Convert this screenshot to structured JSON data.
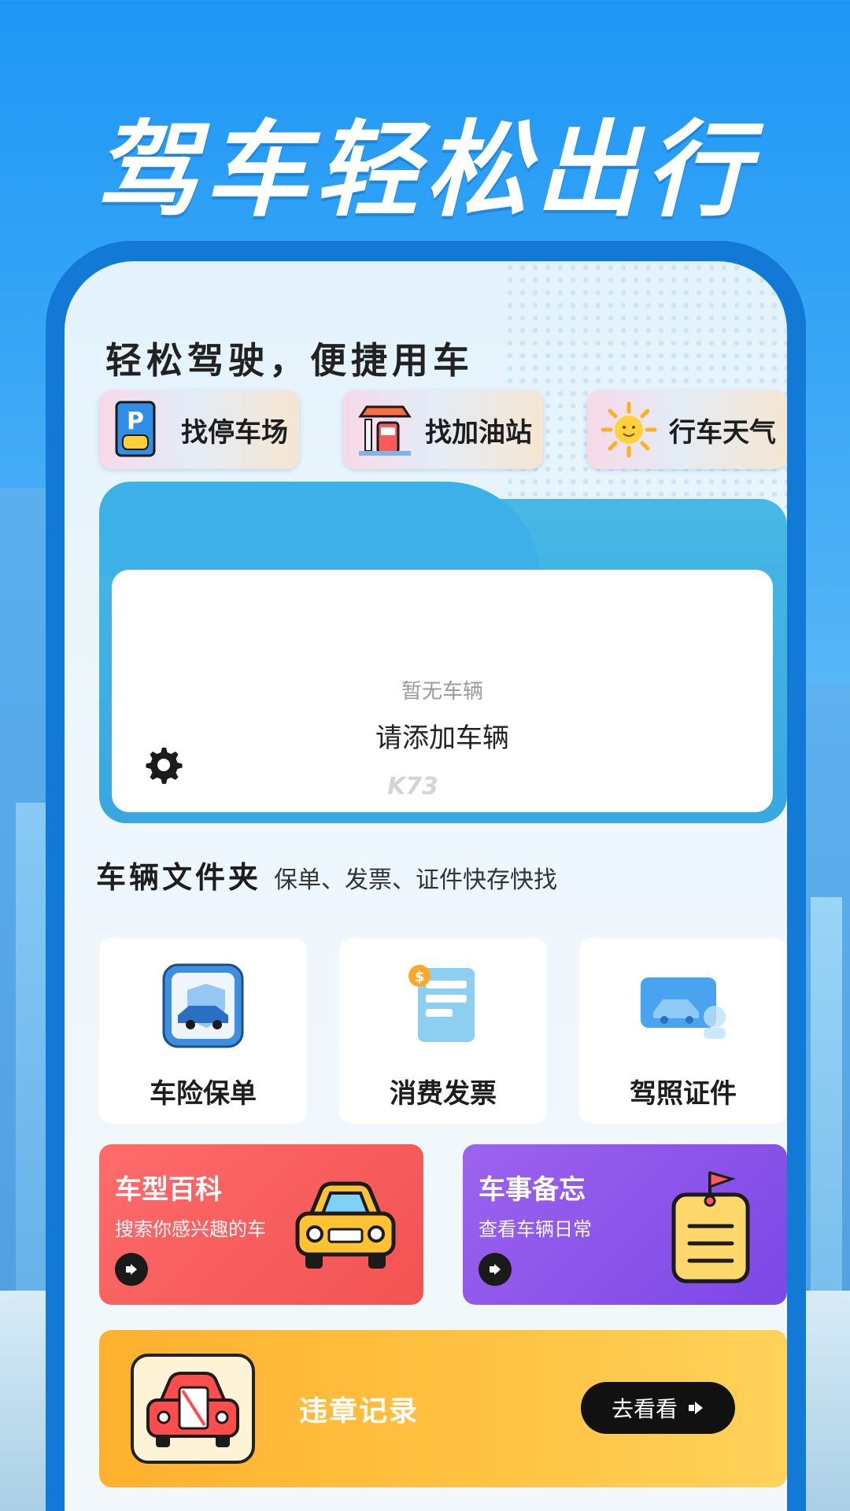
{
  "hero": {
    "title": "驾车轻松出行"
  },
  "screen": {
    "title": "轻松驾驶，便捷用车"
  },
  "quick_actions": [
    {
      "label": "找停车场",
      "icon": "parking-icon"
    },
    {
      "label": "找加油站",
      "icon": "gas-station-icon"
    },
    {
      "label": "行车天气",
      "icon": "sun-icon"
    }
  ],
  "vehicle": {
    "empty_text": "暂无车辆",
    "add_text": "请添加车辆",
    "watermark": "K73"
  },
  "folder": {
    "title": "车辆文件夹",
    "subtitle": "保单、发票、证件快存快找",
    "items": [
      {
        "label": "车险保单",
        "icon": "insurance-policy-icon"
      },
      {
        "label": "消费发票",
        "icon": "invoice-icon"
      },
      {
        "label": "驾照证件",
        "icon": "license-icon"
      }
    ]
  },
  "promos": [
    {
      "title": "车型百科",
      "subtitle": "搜索你感兴趣的车",
      "icon": "car-icon",
      "color": "#f25252"
    },
    {
      "title": "车事备忘",
      "subtitle": "查看车辆日常",
      "icon": "memo-icon",
      "color": "#7b47e6"
    }
  ],
  "violation": {
    "title": "违章记录",
    "button": "去看看"
  },
  "colors": {
    "primary": "#1279d6",
    "accent_yellow": "#ffb02e"
  }
}
